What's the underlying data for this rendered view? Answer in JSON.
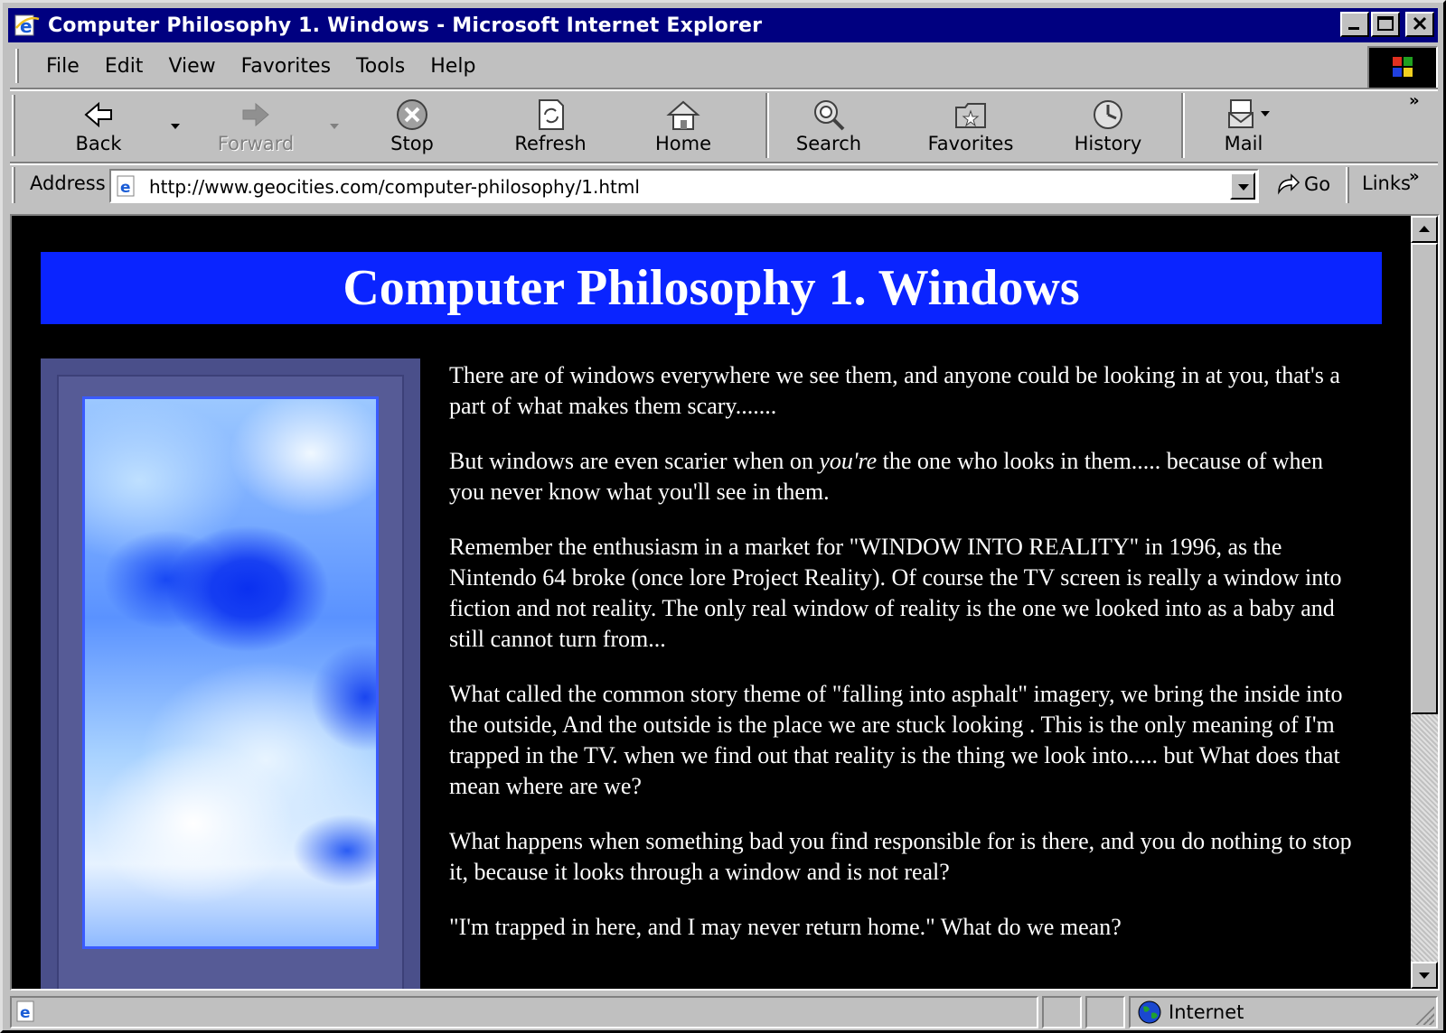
{
  "window": {
    "title": "Computer Philosophy 1. Windows - Microsoft Internet Explorer"
  },
  "menubar": {
    "items": [
      {
        "label": "File"
      },
      {
        "label": "Edit"
      },
      {
        "label": "View"
      },
      {
        "label": "Favorites"
      },
      {
        "label": "Tools"
      },
      {
        "label": "Help"
      }
    ]
  },
  "toolbar": {
    "back": "Back",
    "forward": "Forward",
    "stop": "Stop",
    "refresh": "Refresh",
    "home": "Home",
    "search": "Search",
    "favorites": "Favorites",
    "history": "History",
    "mail": "Mail",
    "more": "»"
  },
  "address_bar": {
    "label": "Address",
    "url": "http://www.geocities.com/computer-philosophy/1.html",
    "go": "Go",
    "links": "Links",
    "more": "»"
  },
  "page": {
    "heading": "Computer Philosophy 1. Windows",
    "paragraphs": {
      "p1": "There are of windows everywhere we see them, and anyone could be looking in at you, that's a part of what makes them scary.......",
      "p2_before": "But windows are even scarier when on ",
      "p2_em": "you're",
      "p2_after": " the one who looks in them..... because of when you never know what you'll see in them.",
      "p3": "Remember the enthusiasm in a market for \"WINDOW INTO REALITY\" in 1996, as the Nintendo 64 broke (once lore Project Reality). Of course the TV screen is really a window into fiction and not reality. The only real window of reality is the one we looked into as a baby and still cannot turn from...",
      "p4": "What called the common story theme of \"falling into asphalt\" imagery, we bring the inside into the outside, And the outside is the place we are stuck looking . This is the only meaning of I'm trapped in the TV. when we find out that reality is the thing we look into..... but What does that mean where are we?",
      "p5": "What happens when something bad you find responsible for is there, and you do nothing to stop it, because it looks through a window and is not real?",
      "p6": "\"I'm trapped in here, and I may never return home.\" What do we mean?"
    }
  },
  "statusbar": {
    "zone": "Internet"
  },
  "colors": {
    "title_bar": "#000080",
    "heading_band": "#0a24ff",
    "page_background": "#000000"
  }
}
